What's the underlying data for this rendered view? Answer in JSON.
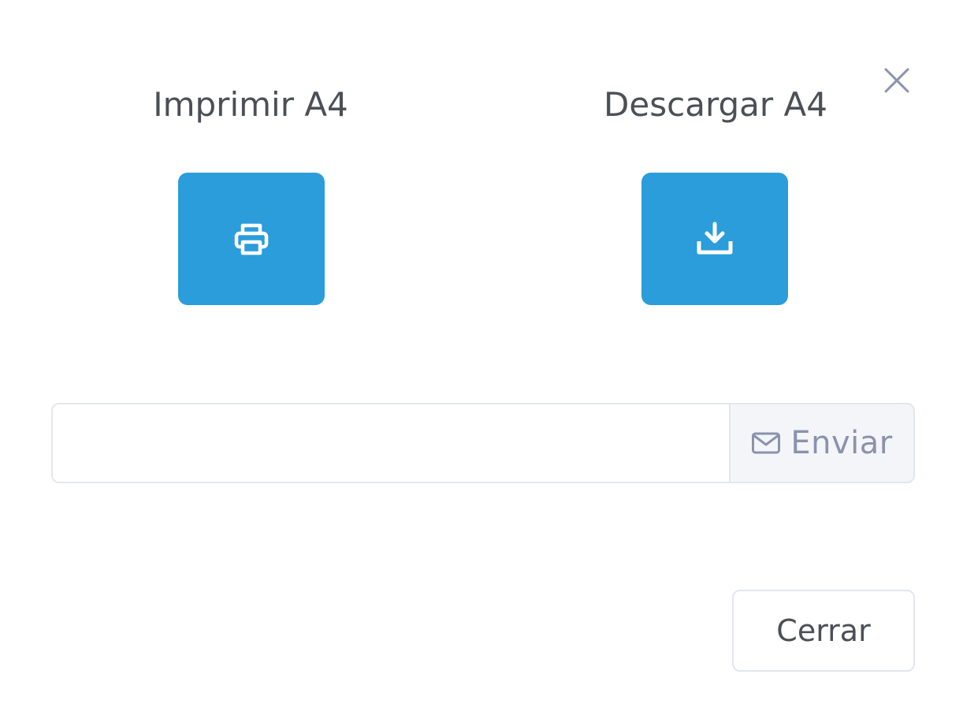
{
  "modal": {
    "close_icon": "close-icon",
    "print": {
      "title": "Imprimir A4",
      "icon": "printer-icon"
    },
    "download": {
      "title": "Descargar A4",
      "icon": "download-icon"
    },
    "email": {
      "value": "",
      "placeholder": "",
      "send_icon": "envelope-icon",
      "send_label": "Enviar"
    },
    "footer": {
      "close_label": "Cerrar"
    }
  },
  "colors": {
    "accent": "#2b9ddb",
    "muted_text": "#8a93ac",
    "border": "#e3e6ee",
    "addon_bg": "#f4f5f9"
  }
}
